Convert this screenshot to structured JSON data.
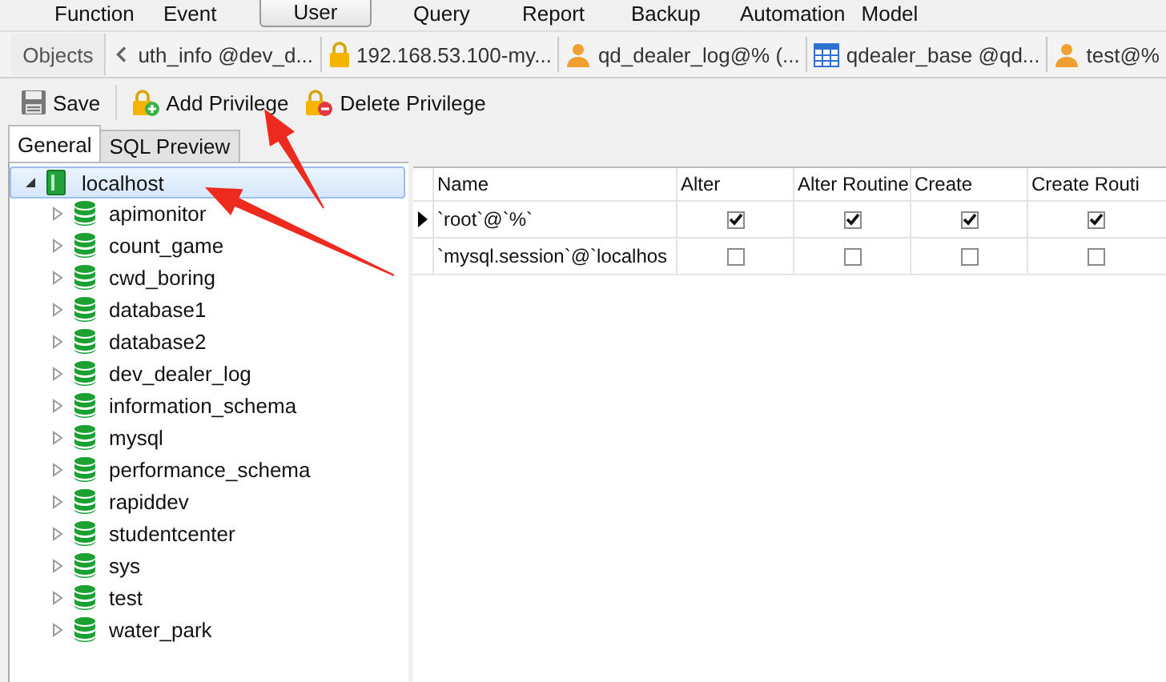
{
  "menu": [
    {
      "label": "Function",
      "selected": false
    },
    {
      "label": "Event",
      "selected": false
    },
    {
      "label": "User",
      "selected": true
    },
    {
      "label": "Query",
      "selected": false
    },
    {
      "label": "Report",
      "selected": false
    },
    {
      "label": "Backup",
      "selected": false
    },
    {
      "label": "Automation",
      "selected": false
    },
    {
      "label": "Model",
      "selected": false
    }
  ],
  "tabs": [
    {
      "label": "Objects",
      "kind": "objects"
    },
    {
      "label": "uth_info @dev_d...",
      "kind": "plain"
    },
    {
      "label": "192.168.53.100-my...",
      "kind": "lock"
    },
    {
      "label": "qd_dealer_log@% (...",
      "kind": "user"
    },
    {
      "label": "qdealer_base @qd...",
      "kind": "table"
    },
    {
      "label": "test@%",
      "kind": "user"
    }
  ],
  "toolbar": [
    {
      "label": "Save",
      "kind": "save"
    },
    {
      "label": "Add Privilege",
      "kind": "add"
    },
    {
      "label": "Delete Privilege",
      "kind": "delete"
    }
  ],
  "subtabs": [
    {
      "label": "General",
      "selected": true
    },
    {
      "label": "SQL Preview",
      "selected": false
    }
  ],
  "tree": [
    {
      "label": "localhost",
      "kind": "server",
      "expanded": true,
      "selected": true,
      "children": [
        {
          "label": "apimonitor",
          "kind": "database",
          "expanded": false,
          "selected": false
        },
        {
          "label": "count_game",
          "kind": "database",
          "expanded": false,
          "selected": false
        },
        {
          "label": "cwd_boring",
          "kind": "database",
          "expanded": false,
          "selected": false
        },
        {
          "label": "database1",
          "kind": "database",
          "expanded": false,
          "selected": false
        },
        {
          "label": "database2",
          "kind": "database",
          "expanded": false,
          "selected": false
        },
        {
          "label": "dev_dealer_log",
          "kind": "database",
          "expanded": false,
          "selected": false
        },
        {
          "label": "information_schema",
          "kind": "database",
          "expanded": false,
          "selected": false
        },
        {
          "label": "mysql",
          "kind": "database",
          "expanded": false,
          "selected": false
        },
        {
          "label": "performance_schema",
          "kind": "database",
          "expanded": false,
          "selected": false
        },
        {
          "label": "rapiddev",
          "kind": "database",
          "expanded": false,
          "selected": false
        },
        {
          "label": "studentcenter",
          "kind": "database",
          "expanded": false,
          "selected": false
        },
        {
          "label": "sys",
          "kind": "database",
          "expanded": false,
          "selected": false
        },
        {
          "label": "test",
          "kind": "database",
          "expanded": false,
          "selected": false
        },
        {
          "label": "water_park",
          "kind": "database",
          "expanded": false,
          "selected": false
        }
      ]
    }
  ],
  "table": {
    "columns": [
      "Name",
      "Alter",
      "Alter Routine",
      "Create",
      "Create Routi"
    ],
    "rows": [
      {
        "selected": true,
        "name": "`root`@`%`",
        "cells": [
          {
            "checked": true
          },
          {
            "checked": true
          },
          {
            "checked": true
          },
          {
            "checked": true
          }
        ]
      },
      {
        "selected": false,
        "name": "`mysql.session`@`localhos",
        "cells": [
          {
            "checked": false
          },
          {
            "checked": false
          },
          {
            "checked": false
          },
          {
            "checked": false
          }
        ]
      }
    ]
  },
  "annotations": [
    {
      "kind": "arrow"
    },
    {
      "kind": "arrow"
    }
  ]
}
